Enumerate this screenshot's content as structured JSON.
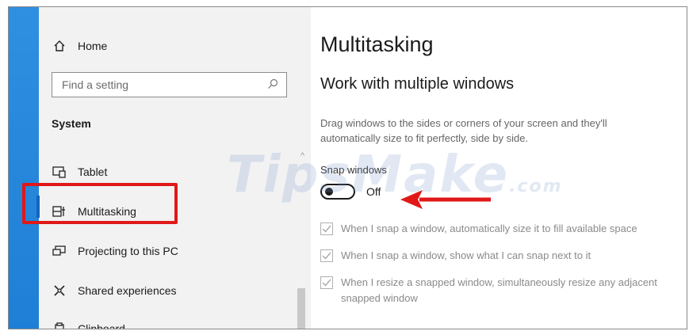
{
  "sidebar": {
    "home_label": "Home",
    "search_placeholder": "Find a setting",
    "section_title": "System",
    "items": [
      {
        "label": "Tablet",
        "icon": "tablet-icon"
      },
      {
        "label": "Multitasking",
        "icon": "multitasking-icon",
        "selected": true
      },
      {
        "label": "Projecting to this PC",
        "icon": "projecting-icon"
      },
      {
        "label": "Shared experiences",
        "icon": "shared-experiences-icon"
      },
      {
        "label": "Clipboard",
        "icon": "clipboard-icon"
      }
    ]
  },
  "main": {
    "title": "Multitasking",
    "subtitle": "Work with multiple windows",
    "description": "Drag windows to the sides or corners of your screen and they'll automatically size to fit perfectly, side by side.",
    "snap_label": "Snap windows",
    "toggle_state": "Off",
    "options": [
      "When I snap a window, automatically size it to fill available space",
      "When I snap a window, show what I can snap next to it",
      "When I resize a snapped window, simultaneously resize any adjacent snapped window"
    ]
  },
  "watermark": {
    "text": "TipsMake",
    "suffix": ".com"
  },
  "colors": {
    "accent": "#1e7fd6",
    "highlight": "#e01818",
    "sidebar_bg": "#f2f2f2"
  }
}
